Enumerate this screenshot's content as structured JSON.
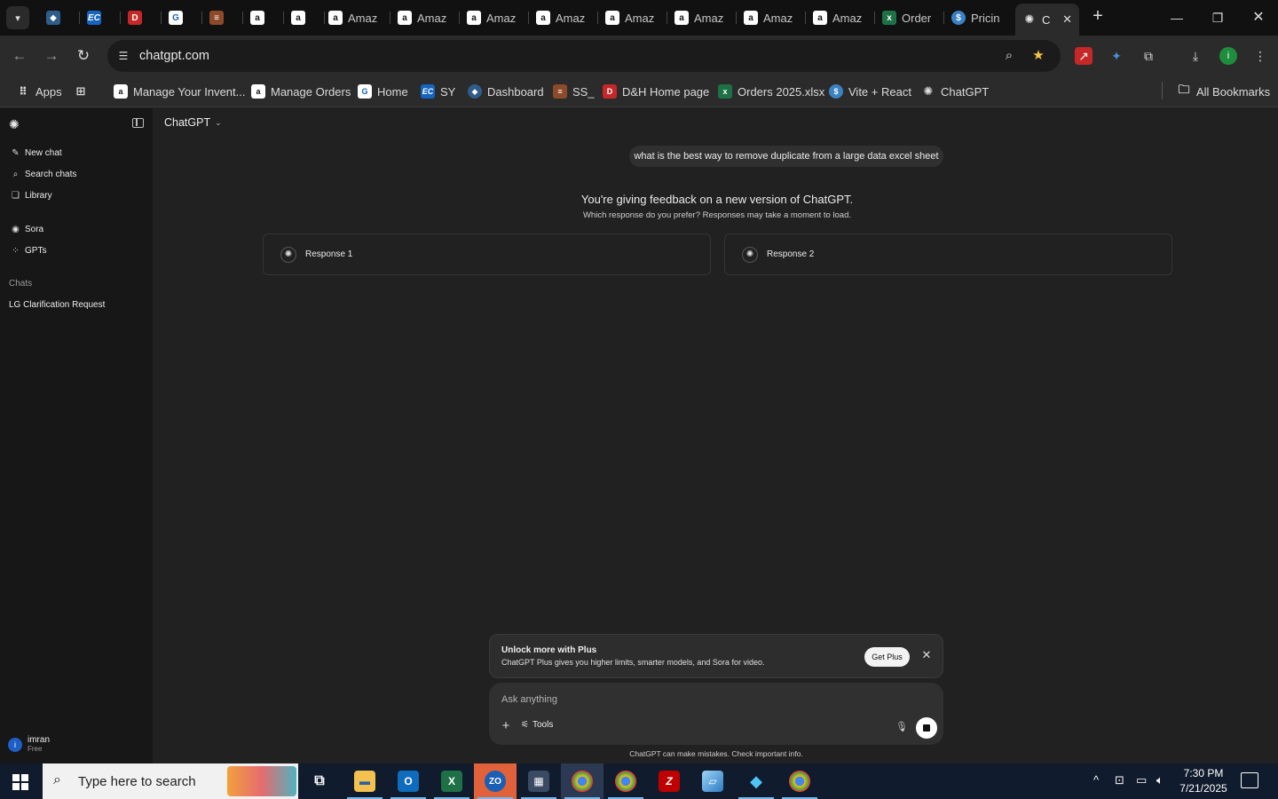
{
  "browser": {
    "tabs": [
      {
        "label": "",
        "icon": "tab-favicon-blue"
      },
      {
        "label": "",
        "icon": "tab-favicon-ec"
      },
      {
        "label": "",
        "icon": "tab-favicon-dh"
      },
      {
        "label": "",
        "icon": "tab-favicon-g"
      },
      {
        "label": "",
        "icon": "tab-favicon-stack"
      },
      {
        "label": "",
        "icon": "tab-favicon-amazon"
      },
      {
        "label": "",
        "icon": "tab-favicon-amazon"
      },
      {
        "label": "Amaz",
        "icon": "tab-favicon-amazon"
      },
      {
        "label": "Amaz",
        "icon": "tab-favicon-amazon"
      },
      {
        "label": "Amaz",
        "icon": "tab-favicon-amazon"
      },
      {
        "label": "Amaz",
        "icon": "tab-favicon-amazon"
      },
      {
        "label": "Amaz",
        "icon": "tab-favicon-amazon"
      },
      {
        "label": "Amaz",
        "icon": "tab-favicon-amazon"
      },
      {
        "label": "Amaz",
        "icon": "tab-favicon-amazon"
      },
      {
        "label": "Amaz",
        "icon": "tab-favicon-amazon"
      },
      {
        "label": "Order",
        "icon": "tab-favicon-excel"
      },
      {
        "label": "Pricin",
        "icon": "tab-favicon-dollar"
      },
      {
        "label": "C",
        "icon": "tab-favicon-chatgpt"
      }
    ],
    "url": "chatgpt.com",
    "bookmarks": [
      {
        "label": "Apps"
      },
      {
        "label": ""
      },
      {
        "label": "Manage Your Invent..."
      },
      {
        "label": "Manage Orders"
      },
      {
        "label": "Home"
      },
      {
        "label": "SY"
      },
      {
        "label": "Dashboard"
      },
      {
        "label": "SS_"
      },
      {
        "label": "D&H Home page"
      },
      {
        "label": "Orders 2025.xlsx"
      },
      {
        "label": "Vite + React"
      },
      {
        "label": "ChatGPT"
      }
    ],
    "all_bookmarks": "All Bookmarks",
    "profile_initial": "i"
  },
  "sidebar": {
    "items": [
      {
        "label": "New chat"
      },
      {
        "label": "Search chats"
      },
      {
        "label": "Library"
      },
      {
        "label": "Sora"
      },
      {
        "label": "GPTs"
      }
    ],
    "chats_heading": "Chats",
    "chats": [
      "LG Clarification Request"
    ],
    "user": {
      "name": "imran",
      "plan": "Free",
      "initial": "i"
    }
  },
  "main": {
    "model": "ChatGPT",
    "user_message": "what is the best way to remove duplicate from a large data excel sheet",
    "feedback_title": "You're giving feedback on a new version of ChatGPT.",
    "feedback_sub": "Which response do you prefer? Responses may take a moment to load.",
    "responses": [
      "Response 1",
      "Response 2"
    ],
    "promo": {
      "title": "Unlock more with Plus",
      "text": "ChatGPT Plus gives you higher limits, smarter models, and Sora for video.",
      "button": "Get Plus"
    },
    "composer": {
      "placeholder": "Ask anything",
      "tools": "Tools"
    },
    "disclaimer": "ChatGPT can make mistakes. Check important info."
  },
  "taskbar": {
    "search_placeholder": "Type here to search",
    "time": "7:30 PM",
    "date": "7/21/2025"
  },
  "colors": {
    "app_bg": "#212121",
    "sidebar_bg": "#171717",
    "chrome_bg": "#2b2b2b",
    "taskbar_bg": "#101b2d"
  }
}
